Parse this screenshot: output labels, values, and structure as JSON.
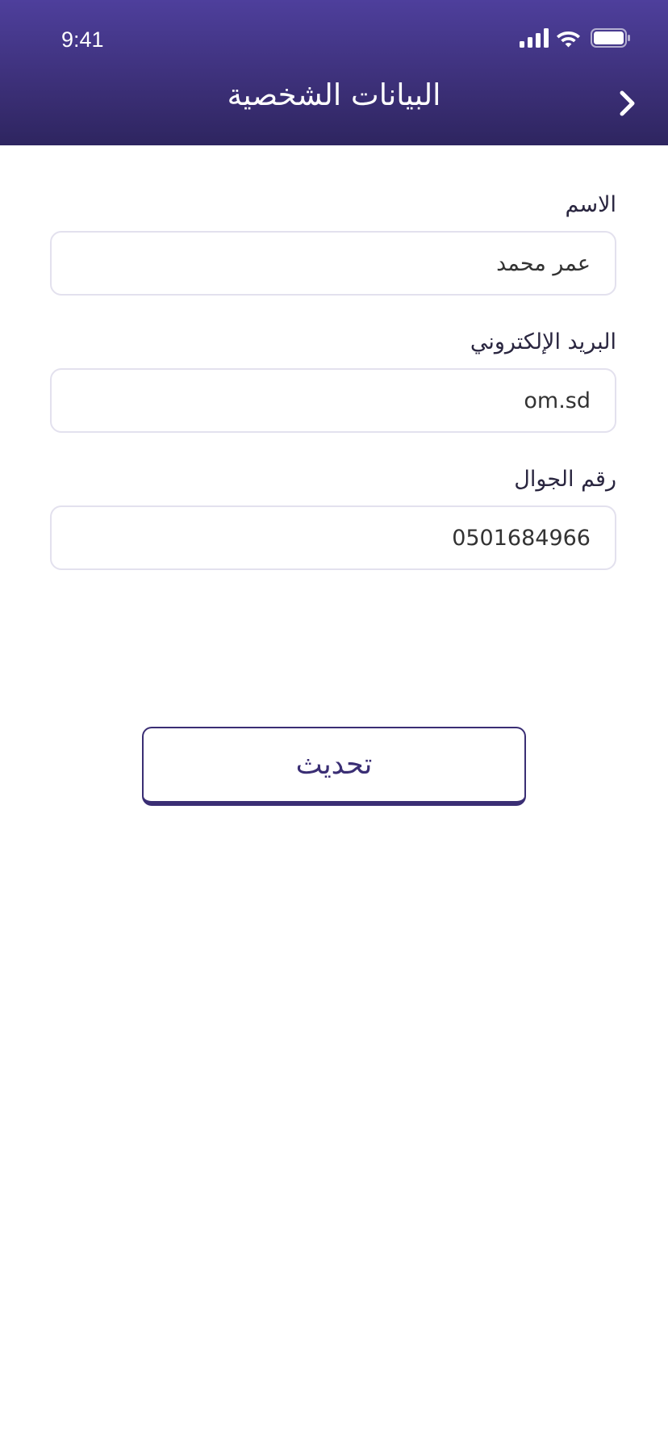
{
  "status_bar": {
    "time": "9:41",
    "icons": [
      "signal-icon",
      "wifi-icon",
      "battery-icon"
    ]
  },
  "header": {
    "title": "البيانات الشخصية",
    "back_icon": "chevron-right-icon",
    "gradient_colors": [
      "#4e3f9c",
      "#2e2560"
    ]
  },
  "form": {
    "name": {
      "label": "الاسم",
      "value": "عمر محمد"
    },
    "email": {
      "label": "البريد الإلكتروني",
      "value": "om.sd"
    },
    "phone": {
      "label": "رقم الجوال",
      "value": "0501684966"
    }
  },
  "actions": {
    "update_label": "تحديث",
    "accent_color": "#3a2e74"
  }
}
